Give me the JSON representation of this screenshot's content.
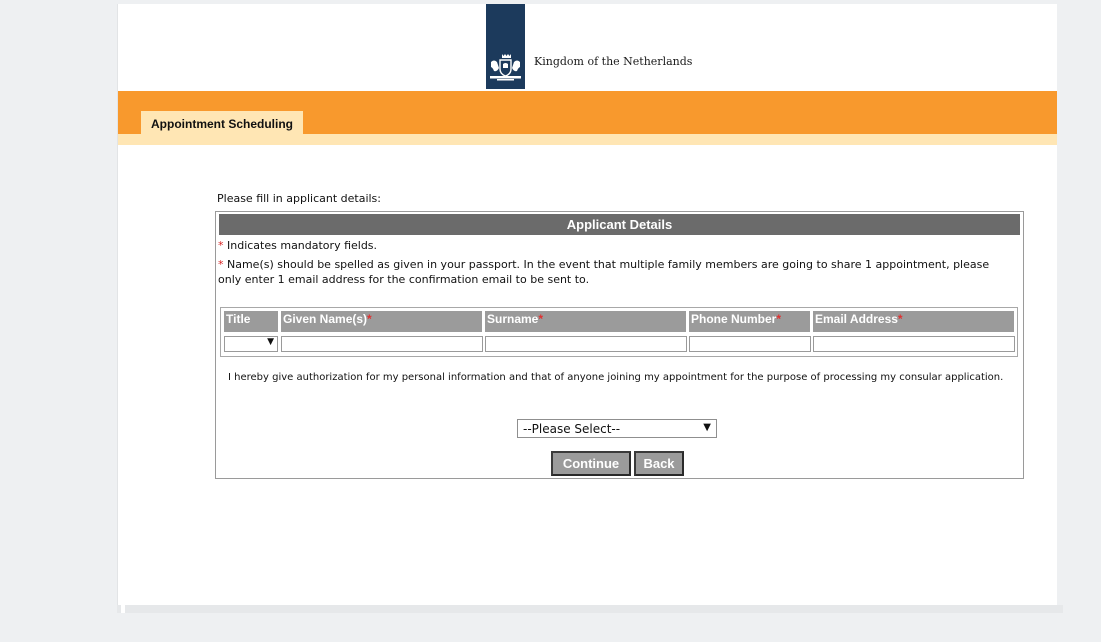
{
  "header": {
    "logo_text": "Kingdom of the Netherlands",
    "tab_label": "Appointment Scheduling",
    "colors": {
      "brand_blue": "#1c3a5c",
      "orange": "#f8992d",
      "cream": "#ffe6b4"
    }
  },
  "form": {
    "intro": "Please fill in applicant details:",
    "section_title": "Applicant Details",
    "mandatory_mark": "*",
    "note_mandatory": " Indicates mandatory fields.",
    "note_passport": " Name(s) should be spelled as given in your passport. In the event that multiple family members are going to share 1 appointment, please only enter 1 email address for the confirmation email to be sent to.",
    "columns": {
      "title": "Title",
      "given_names": "Given Name(s)",
      "surname": "Surname",
      "phone": "Phone Number",
      "email": "Email Address"
    },
    "values": {
      "title": "",
      "given_names": "",
      "surname": "",
      "phone": "",
      "email": ""
    },
    "consent_text": "I hereby give authorization for my personal information and that of anyone joining my appointment for the purpose of processing my consular application.",
    "consent_select": "--Please Select--",
    "continue_label": "Continue",
    "back_label": "Back"
  }
}
